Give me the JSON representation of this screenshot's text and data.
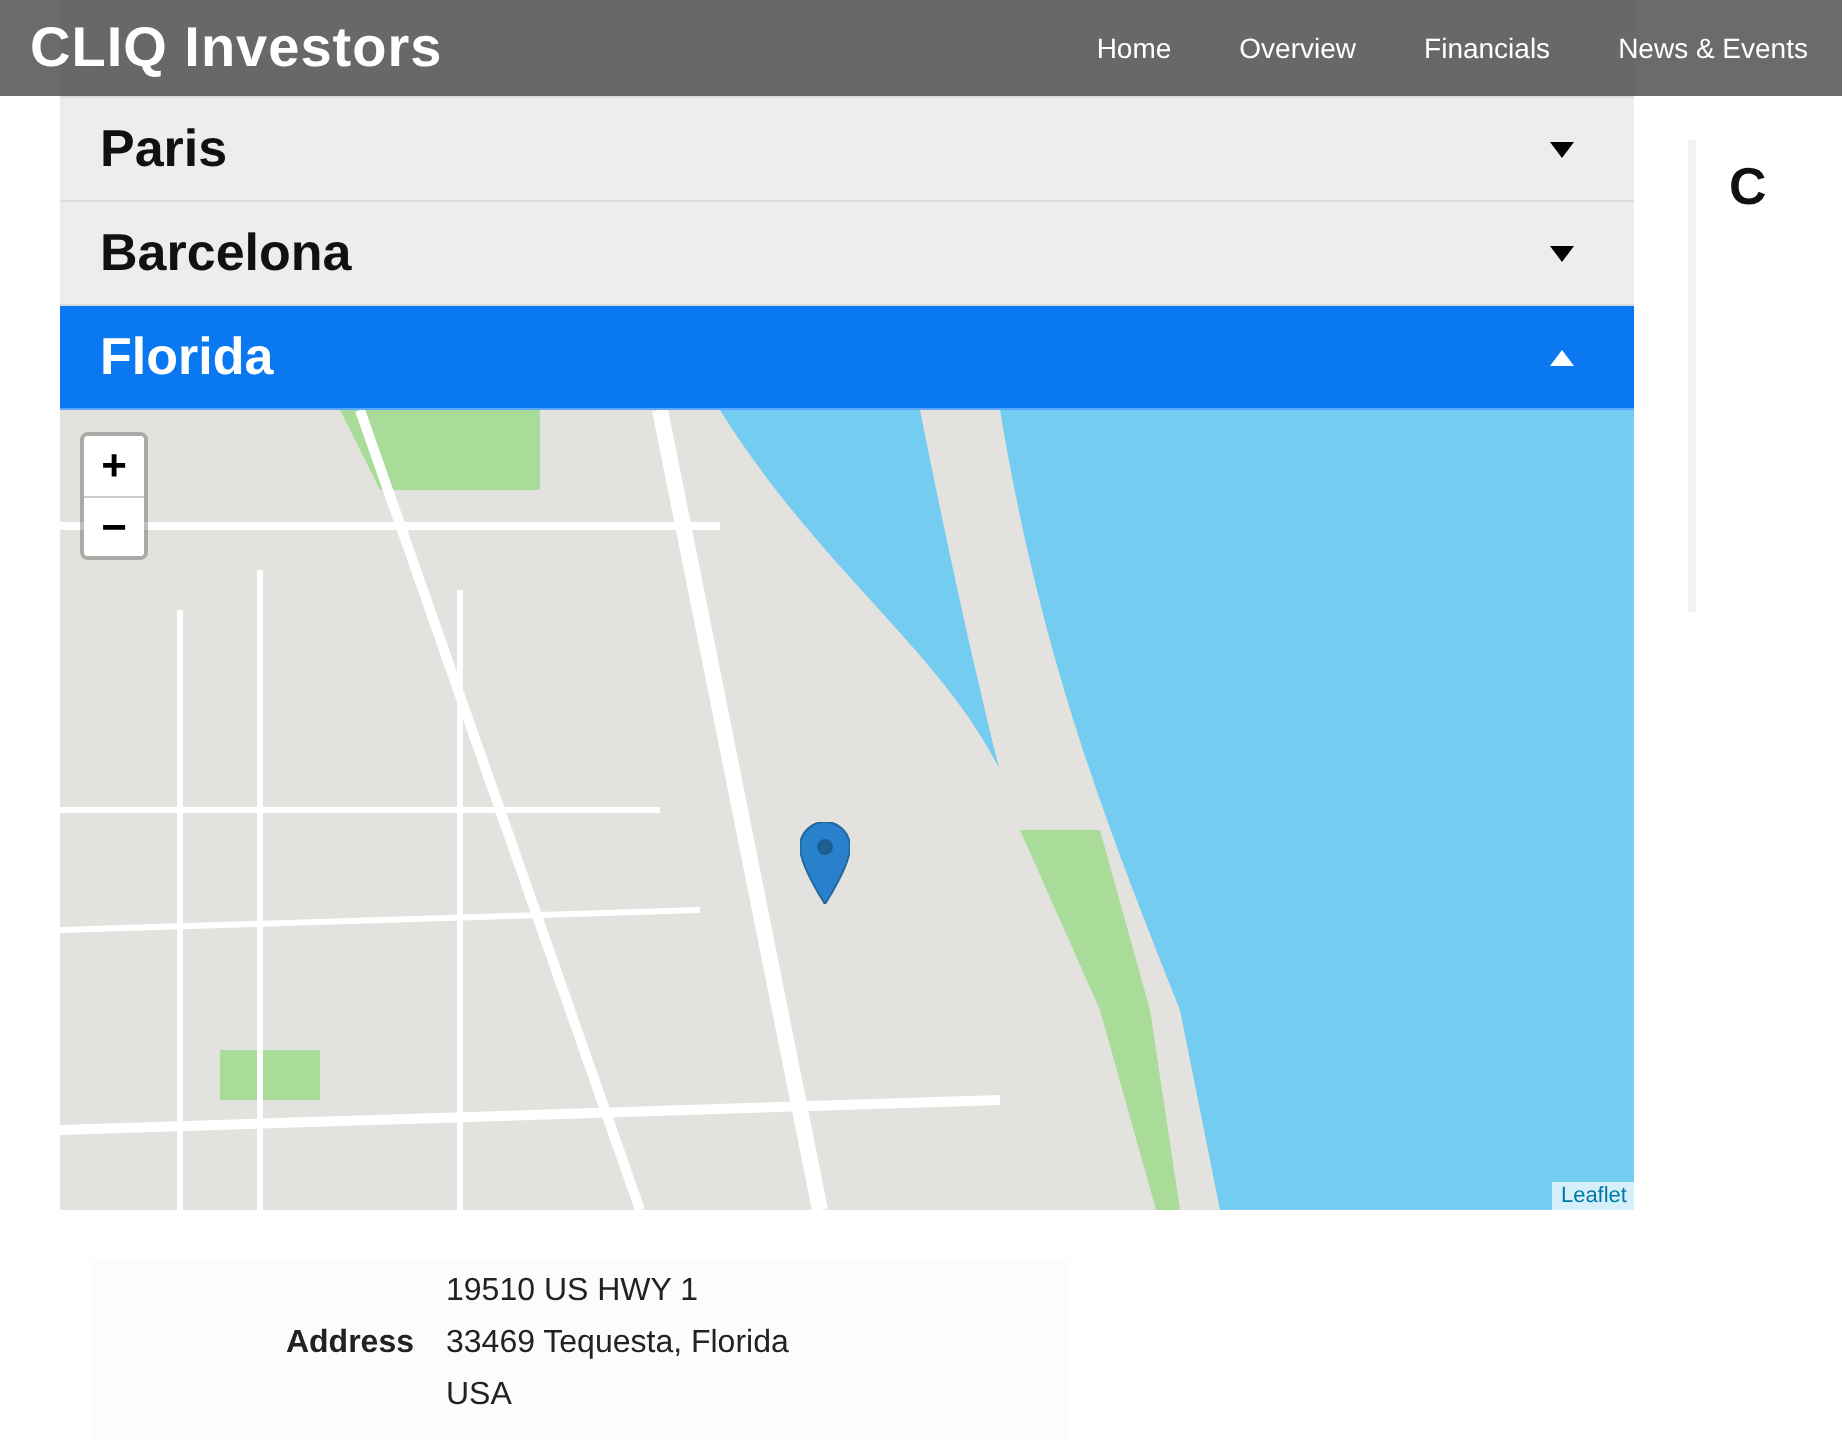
{
  "header": {
    "logo": "CLIQ Investors",
    "nav": [
      {
        "label": "Home"
      },
      {
        "label": "Overview"
      },
      {
        "label": "Financials"
      },
      {
        "label": "News & Events"
      }
    ]
  },
  "accordion": [
    {
      "title": "Paris",
      "expanded": false
    },
    {
      "title": "Barcelona",
      "expanded": false
    },
    {
      "title": "Florida",
      "expanded": true,
      "map": {
        "zoom_in": "+",
        "zoom_out": "−",
        "attribution": "Leaflet"
      },
      "address": {
        "label": "Address",
        "lines": [
          "19510 US HWY 1",
          "33469 Tequesta, Florida",
          "USA"
        ]
      }
    }
  ],
  "side_card": {
    "title": "C"
  }
}
